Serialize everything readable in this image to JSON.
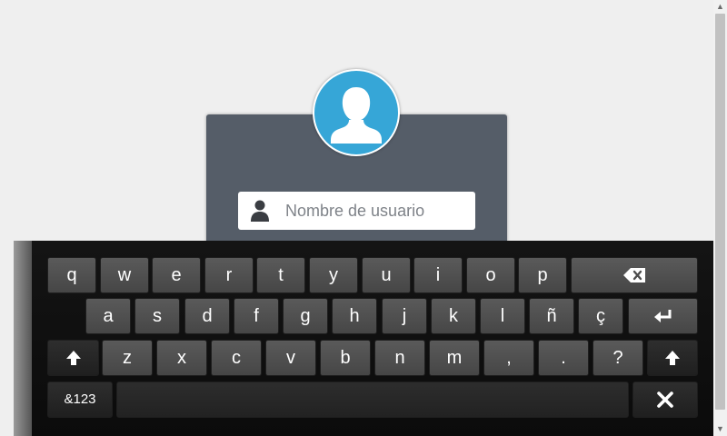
{
  "login": {
    "username_placeholder": "Nombre de usuario"
  },
  "keyboard": {
    "row1": [
      "q",
      "w",
      "e",
      "r",
      "t",
      "y",
      "u",
      "i",
      "o",
      "p"
    ],
    "row2": [
      "a",
      "s",
      "d",
      "f",
      "g",
      "h",
      "j",
      "k",
      "l",
      "ñ",
      "ç"
    ],
    "row3": [
      "z",
      "x",
      "c",
      "v",
      "b",
      "n",
      "m",
      ",",
      ".",
      "?"
    ],
    "symbols_label": "&123"
  },
  "colors": {
    "accent": "#36a6d7",
    "panel": "#555d68",
    "background": "#efefef",
    "keyboard_bg": "#111111",
    "key_bg": "#505050"
  },
  "icons": {
    "avatar": "user-silhouette-icon",
    "field": "user-icon",
    "backspace": "backspace-icon",
    "enter": "enter-icon",
    "shift": "shift-arrow-icon",
    "close": "close-icon"
  }
}
